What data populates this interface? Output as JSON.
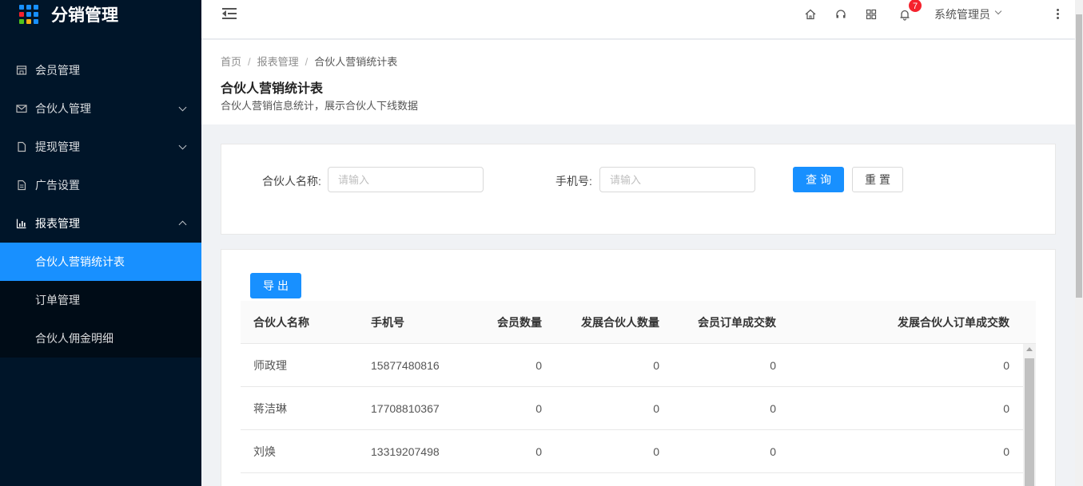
{
  "app": {
    "title": "分销管理"
  },
  "sidebar": {
    "items": [
      {
        "label": "会员管理",
        "icon": "shop-icon"
      },
      {
        "label": "合伙人管理",
        "icon": "mail-icon",
        "expandable": true
      },
      {
        "label": "提现管理",
        "icon": "file-icon",
        "expandable": true
      },
      {
        "label": "广告设置",
        "icon": "file-text-icon"
      },
      {
        "label": "报表管理",
        "icon": "bar-chart-icon",
        "expandable": true,
        "open": true
      }
    ],
    "submenu": [
      {
        "label": "合伙人营销统计表",
        "active": true
      },
      {
        "label": "订单管理"
      },
      {
        "label": "合伙人佣金明细"
      }
    ]
  },
  "header": {
    "notification_count": "7",
    "user": "系统管理员"
  },
  "breadcrumb": [
    "首页",
    "报表管理",
    "合伙人营销统计表"
  ],
  "page": {
    "title": "合伙人营销统计表",
    "description": "合伙人营销信息统计，展示合伙人下线数据"
  },
  "search": {
    "name_label": "合伙人名称:",
    "name_placeholder": "请输入",
    "phone_label": "手机号:",
    "phone_placeholder": "请输入",
    "query_label": "查询",
    "reset_label": "重置"
  },
  "table": {
    "export_label": "导出",
    "columns": [
      "合伙人名称",
      "手机号",
      "会员数量",
      "发展合伙人数量",
      "会员订单成交数",
      "发展合伙人订单成交数"
    ],
    "rows": [
      [
        "师政理",
        "15877480816",
        "0",
        "0",
        "0",
        "0"
      ],
      [
        "蒋洁琳",
        "17708810367",
        "0",
        "0",
        "0",
        "0"
      ],
      [
        "刘焕",
        "13319207498",
        "0",
        "0",
        "0",
        "0"
      ]
    ]
  },
  "colors": {
    "sidebar_bg": "#001529",
    "submenu_bg": "#000c17",
    "primary": "#1890ff",
    "badge": "#f5222d"
  }
}
